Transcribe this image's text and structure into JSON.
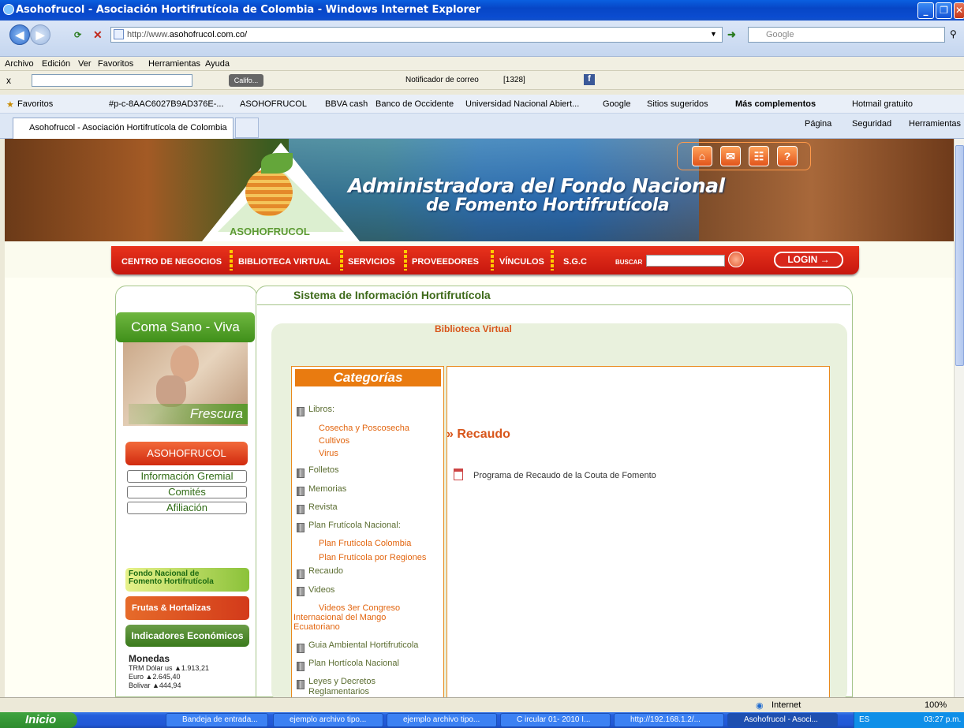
{
  "window": {
    "title": "Asohofrucol - Asociación Hortifrutícola de Colombia - Windows Internet Explorer"
  },
  "address_bar": {
    "url_prefix": "http://www.",
    "url_domain": "asohofrucol.com.co/",
    "search_placeholder": "Google"
  },
  "menu": [
    "Archivo",
    "Edición",
    "Ver",
    "Favoritos",
    "Herramientas",
    "Ayuda"
  ],
  "toolbar": {
    "close_x": "x",
    "califo": "Califo...",
    "notificador": "Notificador de correo",
    "mail_count": "[1328]"
  },
  "favorites": {
    "label": "Favoritos",
    "items": [
      "#p-c-8AAC6027B9AD376E-...",
      "ASOHOFRUCOL",
      "BBVA cash",
      "Banco de Occidente",
      "Universidad Nacional Abiert...",
      "Google",
      "Sitios sugeridos",
      "Más complementos",
      "Hotmail gratuito"
    ]
  },
  "tab": {
    "label": "Asohofrucol - Asociación Hortifrutícola de Colombia"
  },
  "commandbar": [
    "Página",
    "Seguridad",
    "Herramientas"
  ],
  "banner": {
    "logo_text": "ASOHOFRUCOL",
    "title_line1": "Administradora del Fondo Nacional",
    "title_line2": "de Fomento Hortifrutícola"
  },
  "nav": {
    "items": [
      "CENTRO DE NEGOCIOS",
      "BIBLIOTECA VIRTUAL",
      "SERVICIOS",
      "PROVEEDORES",
      "VÍNCULOS",
      "S.G.C"
    ],
    "search_label": "BUSCAR",
    "login_label": "LOGIN →"
  },
  "main": {
    "section_title": "Sistema de Información Hortifrutícola",
    "page_title": "Biblioteca Virtual",
    "categories_title": "Categorías",
    "content_heading": "» Recaudo",
    "document_link": "Programa de Recaudo de la Couta de Fomento"
  },
  "categories": {
    "libros": "Libros:",
    "libros_sub": [
      "Cosecha y Poscosecha",
      "Cultivos",
      "Virus"
    ],
    "folletos": "Folletos",
    "memorias": "Memorias",
    "revista": "Revista",
    "plan_fruticola": "Plan Frutícola Nacional:",
    "plan_sub": [
      "Plan Frutícola Colombia",
      "Plan Frutícola por Regiones"
    ],
    "recaudo": "Recaudo",
    "videos": "Videos",
    "videos_sub_1": "Videos 3er Congreso",
    "videos_sub_2": "Internacional del Mango",
    "videos_sub_3": "Ecuatoriano",
    "guia": "Guia Ambiental Hortifruticola",
    "plan_horticola": "Plan Hortícola Nacional",
    "leyes": "Leyes y Decretos",
    "leyes_cont": "Reglamentarios"
  },
  "left": {
    "coma_sano": "Coma Sano - Viva Sano",
    "frescura": "Frescura",
    "asohofrucol_btn": "ASOHOFRUCOL",
    "links": [
      "Información Gremial",
      "Comités",
      "Afiliación"
    ],
    "fondo_line1": "Fondo Nacional de",
    "fondo_line2": "Fomento Hortifrutícola",
    "frutas": "Frutas & Hortalizas",
    "indicadores": "Indicadores Económicos",
    "monedas": "Monedas",
    "rates": [
      "TRM Dólar us ▲1.913,21",
      "Euro ▲2.645,40",
      "Bolivar ▲444,94"
    ]
  },
  "status": {
    "zone": "Internet",
    "zoom": "100%"
  },
  "taskbar": {
    "start": "Inicio",
    "tasks": [
      "Bandeja de entrada...",
      "ejemplo archivo tipo...",
      "ejemplo archivo tipo...",
      "C ircular 01- 2010 I...",
      "http://192.168.1.2/...",
      "Asohofrucol - Asoci..."
    ],
    "lang": "ES",
    "time": "03:27 p.m."
  }
}
